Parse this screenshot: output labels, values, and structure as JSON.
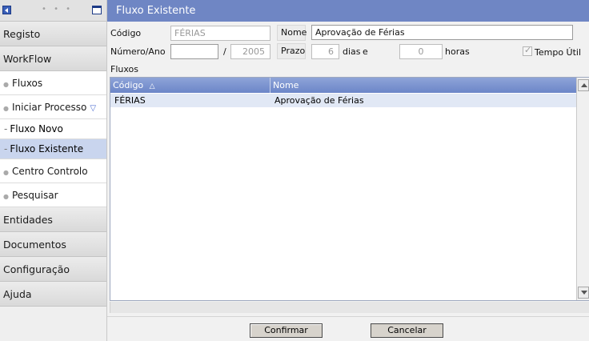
{
  "sidebar": {
    "categories_top": [
      {
        "label": "Registo"
      },
      {
        "label": "WorkFlow"
      }
    ],
    "workflow_items": [
      {
        "label": "Fluxos"
      },
      {
        "label": "Iniciar Processo"
      }
    ],
    "subitems": [
      {
        "label": "Fluxo Novo",
        "active": false
      },
      {
        "label": "Fluxo Existente",
        "active": true
      }
    ],
    "workflow_items2": [
      {
        "label": "Centro Controlo"
      },
      {
        "label": "Pesquisar"
      }
    ],
    "categories_bottom": [
      {
        "label": "Entidades"
      },
      {
        "label": "Documentos"
      },
      {
        "label": "Configuração"
      },
      {
        "label": "Ajuda"
      }
    ],
    "dots": "• • •"
  },
  "main": {
    "title": "Fluxo Existente",
    "form": {
      "codigo_label": "Código",
      "codigo_value": "FÉRIAS",
      "nome_label": "Nome",
      "nome_value": "Aprovação de Férias",
      "numero_ano_label": "Número/Ano",
      "numero_value": "",
      "slash": "/",
      "ano_value": "2005",
      "prazo_label": "Prazo",
      "prazo_dias_value": "6",
      "dias_label": "dias",
      "e_label": "e",
      "prazo_horas_value": "0",
      "horas_label": "horas",
      "tempo_util_label": "Tempo Útil",
      "tempo_util_checked": true
    },
    "fluxos_label": "Fluxos",
    "grid": {
      "columns": [
        "Código",
        "Nome"
      ],
      "sort_indicator": "△",
      "rows": [
        {
          "codigo": "FÉRIAS",
          "nome": "Aprovação de Férias"
        }
      ]
    },
    "buttons": {
      "confirm": "Confirmar",
      "cancel": "Cancelar"
    }
  },
  "colors": {
    "titlebar": "#6f86c4",
    "grid_header": "#7d94d0",
    "selected_row": "#e1e8f5",
    "active_subitem": "#c9d5ee"
  }
}
